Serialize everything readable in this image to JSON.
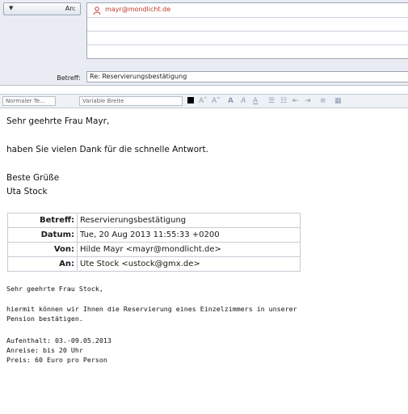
{
  "header": {
    "to_label": "An:",
    "to_value": "mayr@mondlicht.de",
    "subject_label": "Betreff:",
    "subject_value": "Re: Reservierungsbestätigung"
  },
  "toolbar": {
    "paragraph_style": "Normaler Te...",
    "font_width": "Variable Breite",
    "accent_color": "#8a9bb3"
  },
  "message": {
    "greeting": "Sehr geehrte Frau Mayr,",
    "line1": "haben Sie vielen Dank für die schnelle Antwort.",
    "closing": "Beste Grüße",
    "signature": "Uta Stock"
  },
  "quote_header": {
    "subject_key": "Betreff:",
    "subject_val": "Reservierungsbestätigung",
    "date_key": "Datum:",
    "date_val": "Tue, 20 Aug 2013 11:55:33 +0200",
    "from_key": "Von:",
    "from_val": "Hilde Mayr <mayr@mondlicht.de>",
    "to_key": "An:",
    "to_val": "Ute Stock <ustock@gmx.de>"
  },
  "quoted": {
    "greeting": "Sehr geehrte Frau Stock,",
    "line1": "hiermit können wir Ihnen die Reservierung eines Einzelzimmers in unserer",
    "line2": "Pension bestätigen.",
    "stay": "Aufenthalt: 03.-09.05.2013",
    "arrival": "Anreise: bis 20 Uhr",
    "price": "Preis: 60 Euro pro Person"
  }
}
